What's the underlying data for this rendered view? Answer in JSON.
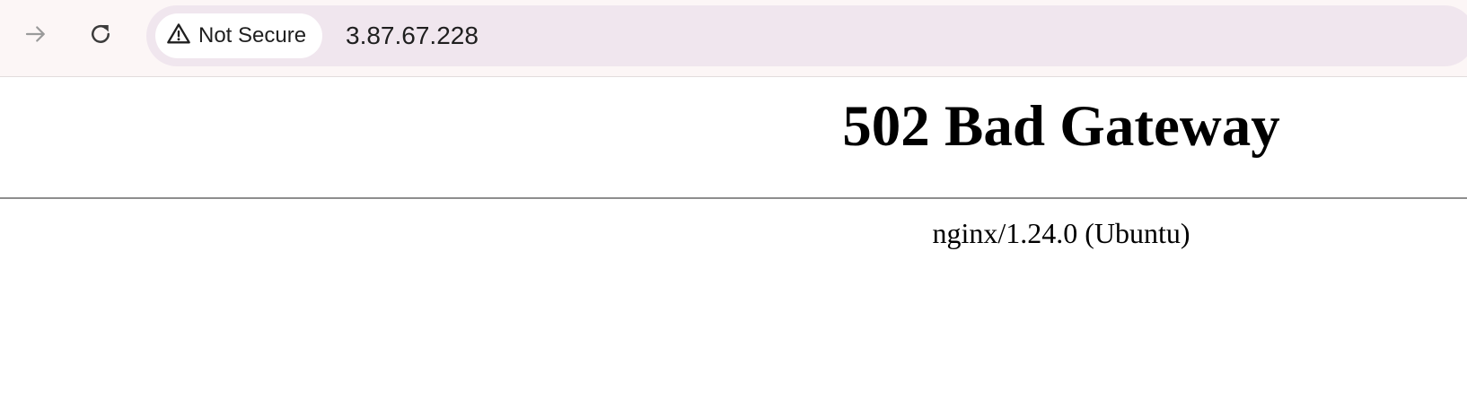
{
  "browser": {
    "forward_icon": "arrow-right-icon",
    "reload_icon": "reload-icon",
    "security_icon": "warning-triangle-icon",
    "security_label": "Not Secure",
    "url": "3.87.67.228",
    "colors": {
      "toolbar_bg": "#fcf6f6",
      "omnibox_bg": "#f0e6ee",
      "chip_bg": "#ffffff",
      "disabled_icon": "#9a9a9a",
      "icon": "#3c3c3c"
    }
  },
  "page": {
    "title": "502 Bad Gateway",
    "server": "nginx/1.24.0 (Ubuntu)"
  }
}
